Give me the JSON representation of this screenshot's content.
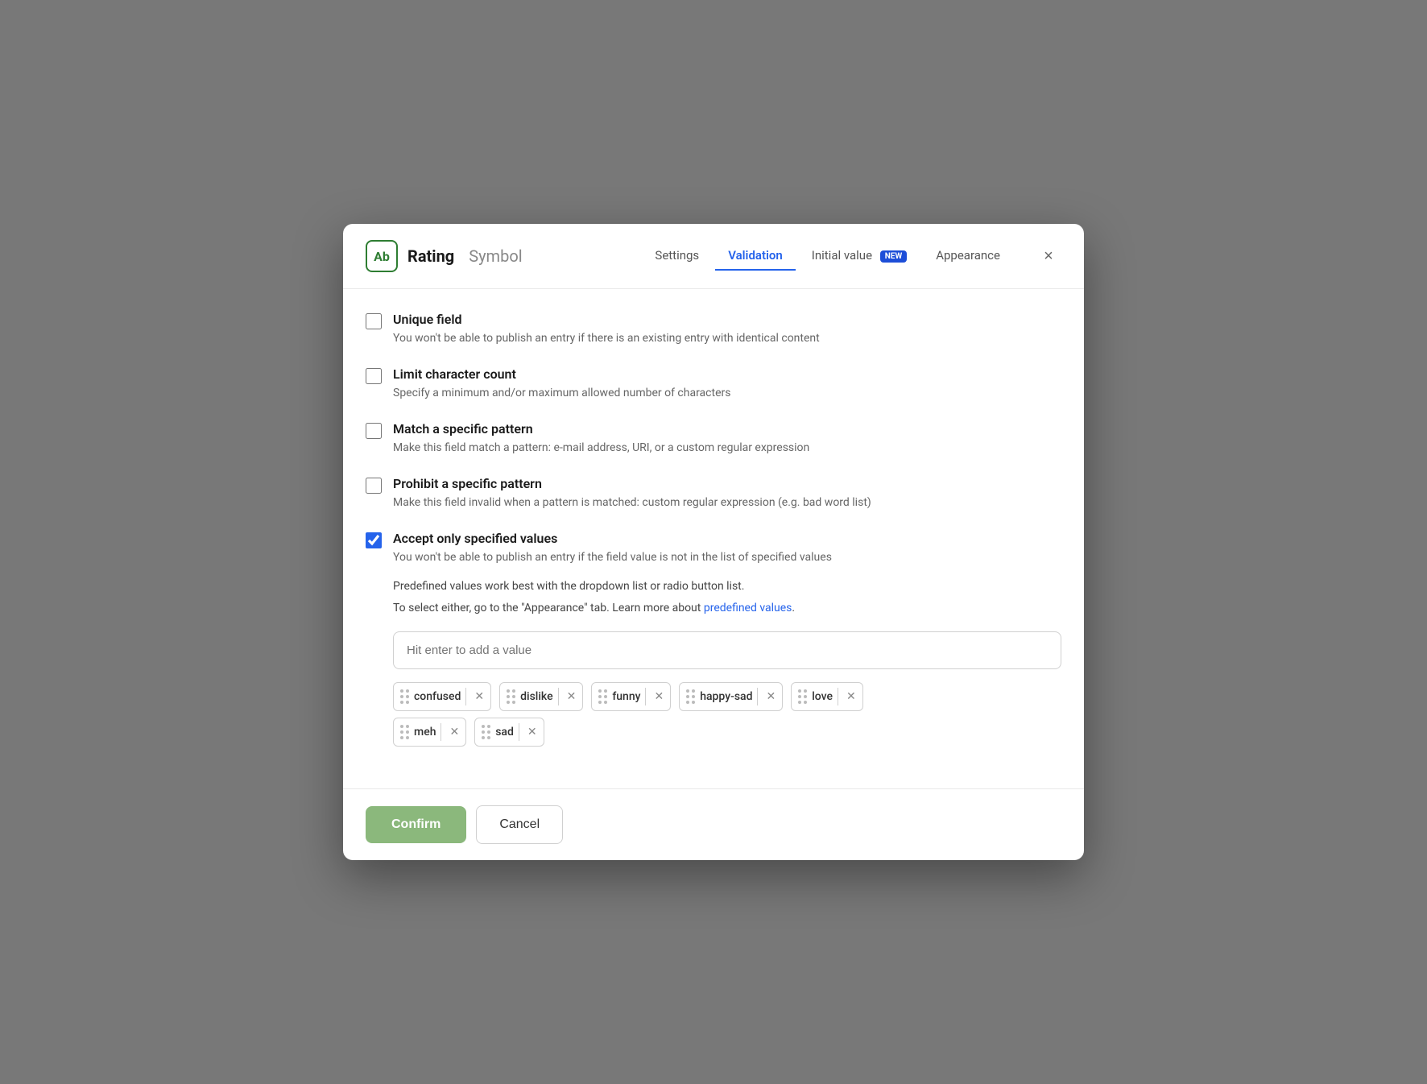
{
  "modal": {
    "field_icon": "Ab",
    "field_name": "Rating",
    "field_type": "Symbol",
    "tabs": [
      {
        "id": "settings",
        "label": "Settings",
        "active": false
      },
      {
        "id": "validation",
        "label": "Validation",
        "active": true
      },
      {
        "id": "initial_value",
        "label": "Initial value",
        "active": false,
        "badge": "NEW"
      },
      {
        "id": "appearance",
        "label": "Appearance",
        "active": false
      }
    ],
    "close_label": "×",
    "validation_options": [
      {
        "id": "unique_field",
        "title": "Unique field",
        "description": "You won't be able to publish an entry if there is an existing entry with identical content",
        "checked": false
      },
      {
        "id": "limit_character_count",
        "title": "Limit character count",
        "description": "Specify a minimum and/or maximum allowed number of characters",
        "checked": false
      },
      {
        "id": "match_specific_pattern",
        "title": "Match a specific pattern",
        "description": "Make this field match a pattern: e-mail address, URI, or a custom regular expression",
        "checked": false
      },
      {
        "id": "prohibit_specific_pattern",
        "title": "Prohibit a specific pattern",
        "description": "Make this field invalid when a pattern is matched: custom regular expression (e.g. bad word list)",
        "checked": false
      },
      {
        "id": "accept_only_specified",
        "title": "Accept only specified values",
        "description": "You won't be able to publish an entry if the field value is not in the list of specified values",
        "checked": true
      }
    ],
    "predefined_info_line1": "Predefined values work best with the dropdown list or radio button list.",
    "predefined_info_line2": "To select either, go to the \"Appearance\" tab.",
    "predefined_link_text": "Learn more about",
    "predefined_link_anchor": "predefined values",
    "value_input_placeholder": "Hit enter to add a value",
    "tags": [
      {
        "id": "confused",
        "label": "confused"
      },
      {
        "id": "dislike",
        "label": "dislike"
      },
      {
        "id": "funny",
        "label": "funny"
      },
      {
        "id": "happy-sad",
        "label": "happy-sad"
      },
      {
        "id": "love",
        "label": "love"
      },
      {
        "id": "meh",
        "label": "meh"
      },
      {
        "id": "sad",
        "label": "sad"
      }
    ],
    "footer": {
      "confirm_label": "Confirm",
      "cancel_label": "Cancel"
    }
  }
}
